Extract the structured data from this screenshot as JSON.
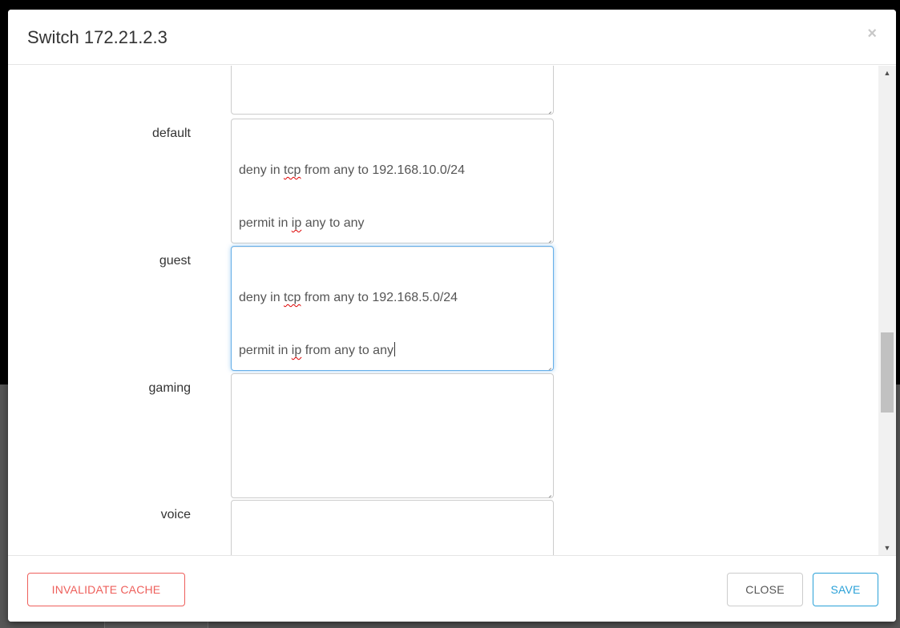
{
  "modal": {
    "title": "Switch 172.21.2.3",
    "close_glyph": "×"
  },
  "fields": [
    {
      "label": "",
      "value": ""
    },
    {
      "label": "default",
      "lines": [
        "deny in tcp from any to 192.168.10.0/24",
        "permit in ip any to any"
      ]
    },
    {
      "label": "guest",
      "lines": [
        "deny in tcp from any to 192.168.5.0/24",
        "permit in ip from any to any"
      ]
    },
    {
      "label": "gaming",
      "value": ""
    },
    {
      "label": "voice",
      "value": ""
    }
  ],
  "text_parts": {
    "default_l1_a": "deny in ",
    "default_l1_b": "tcp",
    "default_l1_c": " from any to 192.168.10.0/24",
    "default_l2_a": "permit in ",
    "default_l2_b": "ip",
    "default_l2_c": " any to any",
    "guest_l1_a": "deny in ",
    "guest_l1_b": "tcp",
    "guest_l1_c": " from any to 192.168.5.0/24",
    "guest_l2_a": "permit in ",
    "guest_l2_b": "ip",
    "guest_l2_c": " from any to any"
  },
  "footer": {
    "invalidate_label": "INVALIDATE CACHE",
    "close_label": "CLOSE",
    "save_label": "SAVE"
  },
  "icons": {
    "close": "close-icon",
    "scroll_up": "arrow-up-icon",
    "scroll_down": "arrow-down-icon"
  },
  "colors": {
    "danger": "#ee5f5b",
    "primary": "#2aa1d8",
    "focus": "#66afe9"
  }
}
